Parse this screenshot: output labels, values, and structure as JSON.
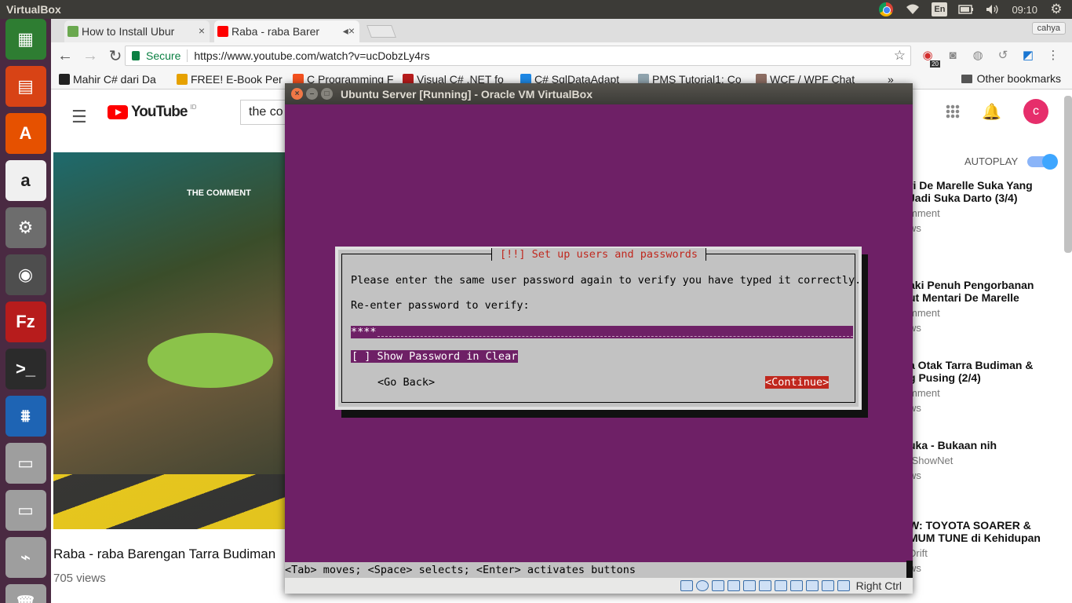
{
  "topbar": {
    "app_name": "VirtualBox",
    "lang": "En",
    "time": "09:10"
  },
  "launcher": {
    "items": [
      {
        "name": "libreoffice-calc-icon",
        "color": "#2e7d32",
        "glyph": "▦"
      },
      {
        "name": "libreoffice-impress-icon",
        "color": "#d84315",
        "glyph": "▤"
      },
      {
        "name": "ubuntu-software-icon",
        "color": "#e65100",
        "glyph": "A"
      },
      {
        "name": "amazon-icon",
        "color": "#f0f0f0",
        "glyph": "a"
      },
      {
        "name": "system-settings-icon",
        "color": "#6d6d6d",
        "glyph": "⚙"
      },
      {
        "name": "chrome-icon",
        "color": "#4e4e4e",
        "glyph": "◉"
      },
      {
        "name": "filezilla-icon",
        "color": "#b71c1c",
        "glyph": "Fz"
      },
      {
        "name": "terminal-icon",
        "color": "#2b2b2b",
        "glyph": ">_"
      },
      {
        "name": "virtualbox-icon",
        "color": "#1e64b4",
        "glyph": "⩩"
      },
      {
        "name": "drive-icon",
        "color": "#9e9e9e",
        "glyph": "▭"
      },
      {
        "name": "drive2-icon",
        "color": "#9e9e9e",
        "glyph": "▭"
      },
      {
        "name": "usb-icon",
        "color": "#9e9e9e",
        "glyph": "⌁"
      },
      {
        "name": "trash-icon",
        "color": "#9e9e9e",
        "glyph": "🗑"
      }
    ]
  },
  "browser": {
    "tabs": [
      {
        "title": "How to Install Ubur",
        "favicon_color": "#6aa84f"
      },
      {
        "title": "Raba - raba Barer",
        "favicon_color": "#ff0000"
      }
    ],
    "user": "cahya",
    "secure_label": "Secure",
    "url": "https://www.youtube.com/watch?v=ucDobzLy4rs",
    "badge_count": "20",
    "bookmarks": [
      {
        "label": "Mahir C# dari Da",
        "color": "#222"
      },
      {
        "label": "FREE! E-Book Per",
        "color": "#e6a100"
      },
      {
        "label": "C Programming F",
        "color": "#f4511e"
      },
      {
        "label": "Visual C# .NET fo",
        "color": "#b71c1c"
      },
      {
        "label": "C# SqlDataAdapt",
        "color": "#1e88e5"
      },
      {
        "label": "PMS Tutorial1: Co",
        "color": "#90a4ae"
      },
      {
        "label": "WCF / WPF Chat",
        "color": "#8d6e63"
      }
    ],
    "bookmarks_more": "»",
    "other_bookmarks": "Other bookmarks"
  },
  "youtube": {
    "logo_text": "YouTube",
    "region": "ID",
    "search_value": "the co",
    "avatar_letter": "c",
    "video_overlay": "THE COMMENT",
    "video_title": "Raba - raba Barengan Tarra Budiman",
    "video_views": "705 views",
    "autoplay_label": "AUTOPLAY",
    "recommendations": [
      {
        "title": "ri De Marelle Suka Yang\nJadi Suka Darto (3/4)",
        "channel": "mment",
        "views": "ws"
      },
      {
        "title": "aki Penuh Pengorbanan\nut Mentari De Marelle",
        "channel": "mment",
        "views": "ws"
      },
      {
        "title": "a Otak Tarra Budiman &\ng Pusing (2/4)",
        "channel": "mment",
        "views": "ws"
      },
      {
        "title": "uka - Bukaan nih",
        "channel": "tShowNet",
        "views": "ws"
      },
      {
        "title": "W: TOYOTA SOARER &\nMUM TUNE di Kehidupan",
        "channel": "Drift",
        "views": "ws"
      }
    ]
  },
  "vbox": {
    "title": "Ubuntu Server [Running] - Oracle VM VirtualBox",
    "dialog_title": "[!!] Set up users and passwords",
    "prompt": "Please enter the same user password again to verify you have typed it correctly.",
    "field_label": "Re-enter password to verify:",
    "password_mask": "****",
    "show_password": "[ ] Show Password in Clear",
    "go_back": "<Go Back>",
    "continue": "<Continue>",
    "help_line": "<Tab> moves; <Space> selects; <Enter> activates buttons",
    "host_key": "Right Ctrl",
    "colors": {
      "screen": "#6e2066",
      "dialog": "#c2c2c2",
      "accent": "#c0281e"
    }
  }
}
